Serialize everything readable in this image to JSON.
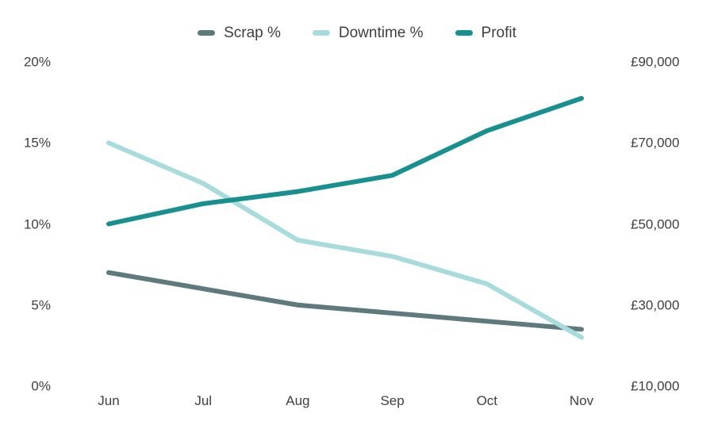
{
  "legend": {
    "position": "top-center",
    "items": [
      {
        "label": "Scrap %",
        "color": "#5f7a7d",
        "axis": "left"
      },
      {
        "label": "Downtime %",
        "color": "#a8dcdc",
        "axis": "left"
      },
      {
        "label": "Profit",
        "color": "#18908f",
        "axis": "right"
      }
    ]
  },
  "chart_data": {
    "type": "line",
    "title": "",
    "subtitle": "",
    "xlabel": "",
    "ylabel": "",
    "grid": false,
    "legend_position": "top-center",
    "categories": [
      "Jun",
      "Jul",
      "Aug",
      "Sep",
      "Oct",
      "Nov"
    ],
    "x_tick_labels": [
      "Jun",
      "Jul",
      "Aug",
      "Sep",
      "Oct",
      "Nov"
    ],
    "left_axis": {
      "label": "",
      "ylim": [
        0,
        20
      ],
      "tick_values": [
        0,
        5,
        10,
        15,
        20
      ],
      "tick_labels": [
        "0%",
        "5%",
        "10%",
        "15%",
        "20%"
      ],
      "unit": "%"
    },
    "right_axis": {
      "label": "",
      "ylim": [
        10000,
        90000
      ],
      "tick_values": [
        10000,
        30000,
        50000,
        70000,
        90000
      ],
      "tick_labels": [
        "£10,000",
        "£30,000",
        "£50,000",
        "£70,000",
        "£90,000"
      ],
      "unit": "£"
    },
    "series": [
      {
        "name": "Scrap %",
        "color": "#5f7a7d",
        "axis": "left",
        "values": [
          7,
          6,
          5,
          4.5,
          4,
          3.5
        ]
      },
      {
        "name": "Downtime %",
        "color": "#a8dcdc",
        "axis": "left",
        "values": [
          15,
          12.5,
          9,
          8,
          6.3,
          3
        ]
      },
      {
        "name": "Profit",
        "color": "#18908f",
        "axis": "right",
        "values": [
          50000,
          55000,
          58000,
          62000,
          73000,
          81000
        ]
      }
    ]
  }
}
